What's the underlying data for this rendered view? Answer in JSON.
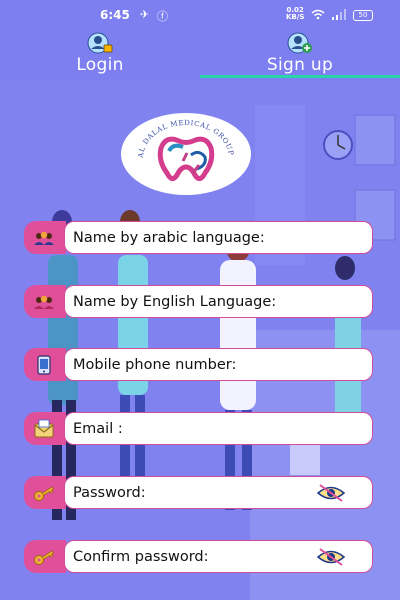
{
  "status_bar": {
    "time": "6:45",
    "net_speed": "0.02",
    "net_unit": "KB/S",
    "battery": "50"
  },
  "tabs": {
    "login": "Login",
    "signup": "Sign up",
    "active": "signup"
  },
  "logo": {
    "arc_text": "AL DALAL MEDICAL GROUP"
  },
  "form": {
    "fields": [
      {
        "placeholder": "Name by arabic language:",
        "icon": "users-icon"
      },
      {
        "placeholder": "Name by English Language:",
        "icon": "users-icon"
      },
      {
        "placeholder": "Mobile phone number:",
        "icon": "phone-icon"
      },
      {
        "placeholder": "Email :",
        "icon": "email-icon"
      },
      {
        "placeholder": "Password:",
        "icon": "key-icon"
      },
      {
        "placeholder": "Confirm password:",
        "icon": "key-icon"
      }
    ]
  },
  "colors": {
    "background": "#7d7ff0",
    "accent_pink": "#e0509a",
    "tab_indicator": "#2bd4a8"
  }
}
